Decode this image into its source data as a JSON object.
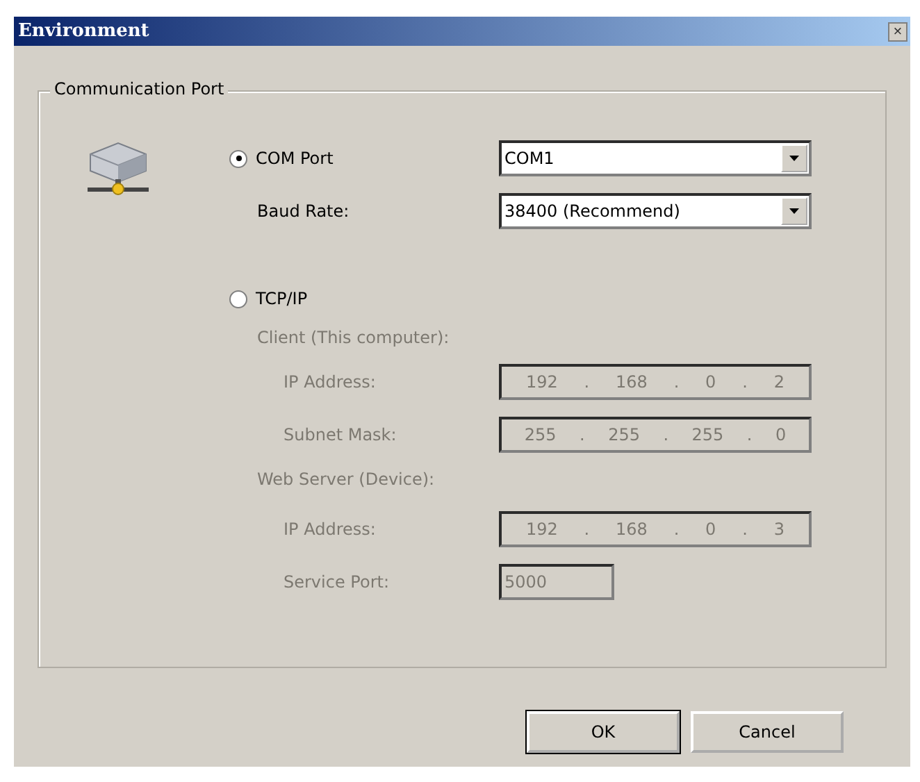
{
  "window": {
    "title": "Environment",
    "close": "×"
  },
  "group": {
    "title": "Communication Port"
  },
  "com": {
    "label": "COM Port",
    "selected": true,
    "port": {
      "value": "COM1"
    },
    "baud": {
      "label": "Baud Rate:",
      "value": "38400 (Recommend)"
    }
  },
  "tcp": {
    "label": "TCP/IP",
    "selected": false,
    "disabled": true,
    "sections": [
      {
        "heading": "Client (This computer):",
        "fields": [
          {
            "kind": "ip",
            "label": "IP Address:",
            "octets": [
              "192",
              "168",
              "0",
              "2"
            ],
            "separator": "."
          },
          {
            "kind": "ip",
            "label": "Subnet Mask:",
            "octets": [
              "255",
              "255",
              "255",
              "0"
            ],
            "separator": "."
          }
        ]
      },
      {
        "heading": "Web Server (Device):",
        "fields": [
          {
            "kind": "ip",
            "label": "IP Address:",
            "octets": [
              "192",
              "168",
              "0",
              "3"
            ],
            "separator": "."
          },
          {
            "kind": "text",
            "label": "Service Port:",
            "value": "5000"
          }
        ]
      }
    ]
  },
  "buttons": [
    {
      "label": "OK",
      "default": true
    },
    {
      "label": "Cancel",
      "default": false
    }
  ]
}
